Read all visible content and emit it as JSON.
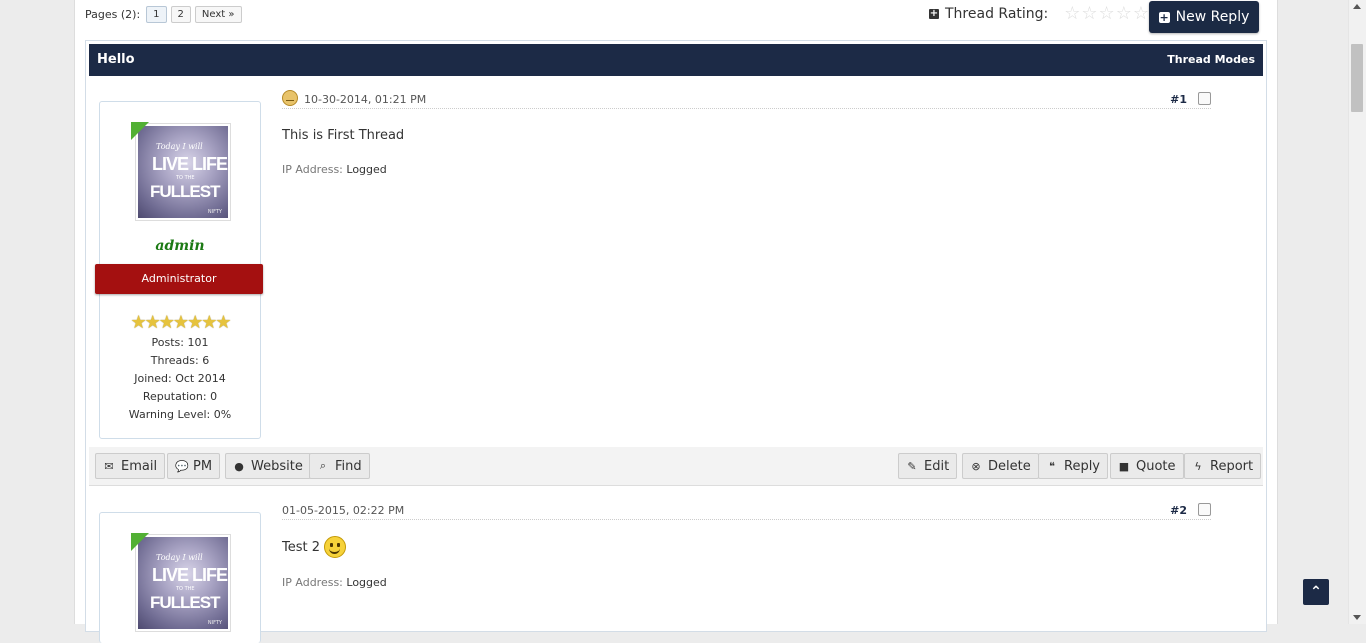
{
  "pagination": {
    "label": "Pages (2):",
    "pages": [
      "1",
      "2"
    ],
    "next": "Next »"
  },
  "rating": {
    "label": "Thread Rating:",
    "stars": [
      "☆",
      "☆",
      "☆",
      "☆",
      "☆"
    ]
  },
  "new_reply": {
    "label": "New Reply"
  },
  "thread": {
    "title": "Hello",
    "modes": "Thread Modes"
  },
  "posts": [
    {
      "author": {
        "avatar_text": [
          "Today I will",
          "LIVE LIFE",
          "TO THE",
          "FULLEST",
          "NIFTY"
        ],
        "username": "admin",
        "usertitle": "Administrator",
        "rank_stars": "★★★★★★★",
        "stats": [
          "Posts: 101",
          "Threads: 6",
          "Joined: Oct 2014",
          "Reputation: 0",
          "Warning Level: 0%"
        ]
      },
      "date": "10-30-2014, 01:21 PM",
      "number": "#1",
      "body": "This is First Thread",
      "ip_label": "IP Address:",
      "ip_value": "Logged"
    },
    {
      "author": {
        "avatar_text": [
          "Today I will",
          "LIVE LIFE",
          "TO THE",
          "FULLEST",
          "NIFTY"
        ]
      },
      "date": "01-05-2015, 02:22 PM",
      "number": "#2",
      "body": "Test 2",
      "ip_label": "IP Address:",
      "ip_value": "Logged"
    }
  ],
  "post_buttons": {
    "left": [
      {
        "label": "Email",
        "icon": "envelope-icon",
        "glyph": "✉"
      },
      {
        "label": "PM",
        "icon": "chat-icon",
        "glyph": "💬"
      },
      {
        "label": "Website",
        "icon": "globe-icon",
        "glyph": "●"
      },
      {
        "label": "Find",
        "icon": "search-icon",
        "glyph": "⌕"
      }
    ],
    "right": [
      {
        "label": "Edit",
        "icon": "edit-icon",
        "glyph": "✎"
      },
      {
        "label": "Delete",
        "icon": "delete-icon",
        "glyph": "⊗"
      },
      {
        "label": "Reply",
        "icon": "quote-icon",
        "glyph": "❝"
      },
      {
        "label": "Quote",
        "icon": "square-icon",
        "glyph": "■"
      },
      {
        "label": "Report",
        "icon": "bolt-icon",
        "glyph": "ϟ"
      }
    ]
  },
  "back_to_top": {
    "glyph": "⌃"
  },
  "colors": {
    "header_bg": "#1c2a46",
    "usertitle_bg": "#a41010",
    "username": "#1c7a14",
    "accent_green": "#52b034"
  }
}
